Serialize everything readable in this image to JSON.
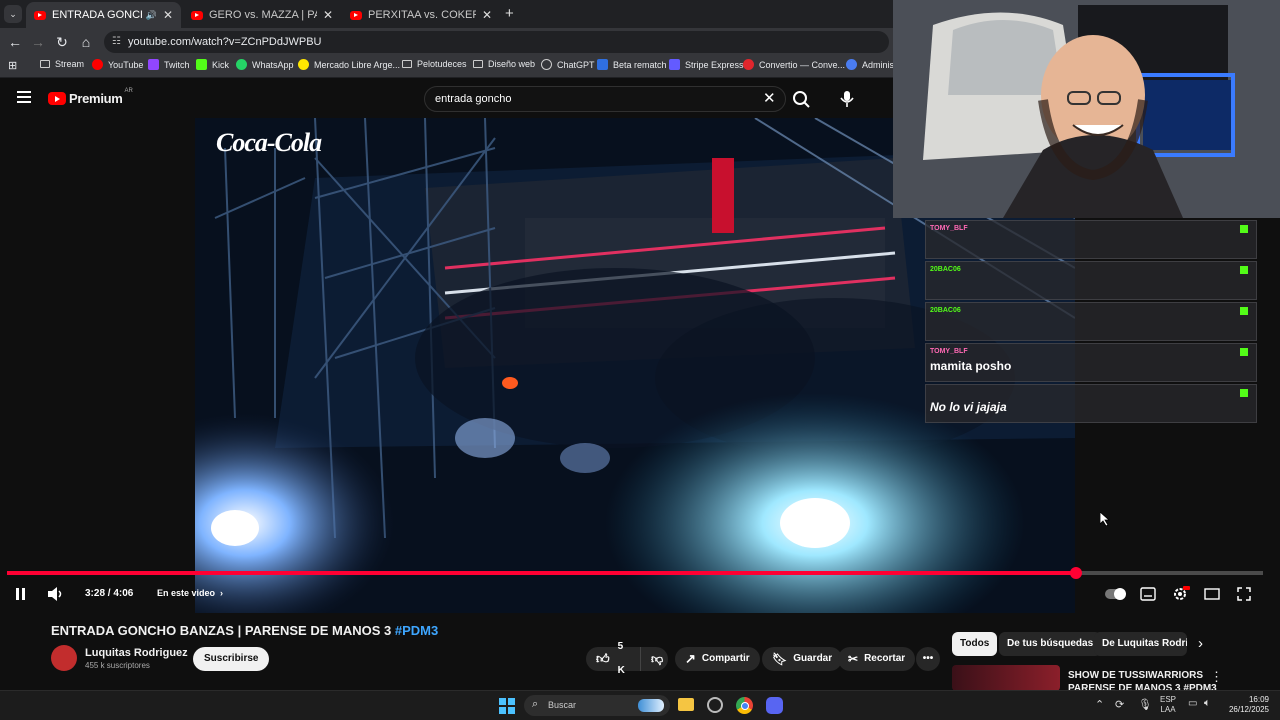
{
  "browser": {
    "tabs": [
      {
        "title": "ENTRADA GONCHO BANZAS"
      },
      {
        "title": "GERO vs. MAZZA | PARENSE DE"
      },
      {
        "title": "PERXITAA vs. COKER | PARENSE"
      }
    ],
    "new_tab": "+",
    "url": "youtube.com/watch?v=ZCnPDdJWPBU",
    "bookmarks": [
      "Stream",
      "YouTube",
      "Twitch",
      "Kick",
      "WhatsApp",
      "Mercado Libre Arge...",
      "Pelotudeces",
      "Diseño web",
      "ChatGPT",
      "Beta rematch",
      "Stripe Express",
      "Convertio — Conve...",
      "Administ"
    ]
  },
  "youtube": {
    "logo": "Premium",
    "region": "AR",
    "search_value": "entrada goncho",
    "video": {
      "brand_overlay": "Coca-Cola",
      "time": "3:28 / 4:06",
      "chapter_label": "En este video",
      "progress_fraction": 0.851
    },
    "title_text": "ENTRADA GONCHO BANZAS | PARENSE DE MANOS 3",
    "hashtag": "#PDM3",
    "channel": {
      "name": "Luquitas Rodriguez",
      "subs": "455 k suscriptores"
    },
    "subscribe": "Suscribirse",
    "likes": "5 K",
    "share": "Compartir",
    "save": "Guardar",
    "clip": "Recortar",
    "chips": [
      "Todos",
      "De tus búsquedas",
      "De Luquitas Rodriguez"
    ],
    "suggested": {
      "title_line1": "SHOW DE TUSSIWARRIORS",
      "title_line2": "PARENSE DE MANOS 3 #PDM3"
    }
  },
  "chat": [
    {
      "user": "TOMY_BLF",
      "text": "",
      "color": "#ff69b4"
    },
    {
      "user": "20BAC06",
      "text": "",
      "color": "#53fc18"
    },
    {
      "user": "20BAC06",
      "text": "",
      "color": "#53fc18"
    },
    {
      "user": "TOMY_BLF",
      "text": "mamita posho",
      "color": "#ff69b4"
    },
    {
      "user": "",
      "text": "No lo vi jajaja",
      "color": "#e0002b"
    }
  ],
  "taskbar": {
    "search": "Buscar",
    "lang1": "ESP",
    "lang2": "LAA",
    "time": "16:09",
    "date": "26/12/2025"
  }
}
